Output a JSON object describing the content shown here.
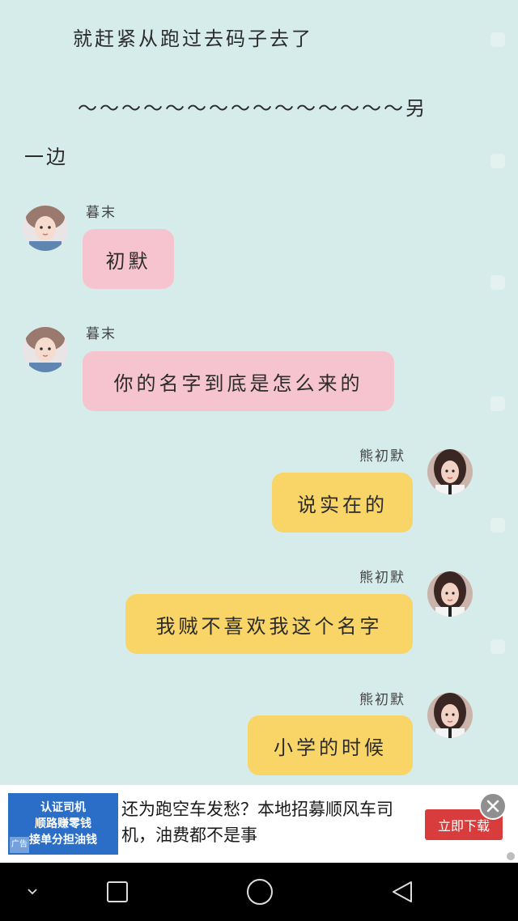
{
  "story": {
    "line1": "就赶紧从跑过去码子去了",
    "line2": "～～～～～～～～～～～～～～～另",
    "line3": "一边"
  },
  "messages": [
    {
      "side": "left",
      "name": "暮末",
      "text": "初默"
    },
    {
      "side": "left",
      "name": "暮末",
      "text": "你的名字到底是怎么来的"
    },
    {
      "side": "right",
      "name": "熊初默",
      "text": "说实在的"
    },
    {
      "side": "right",
      "name": "熊初默",
      "text": "我贼不喜欢我这个名字"
    },
    {
      "side": "right",
      "name": "熊初默",
      "text": "小学的时候"
    }
  ],
  "colors": {
    "background": "#d6ecea",
    "left_bubble": "#f6c4cf",
    "right_bubble": "#f8d566",
    "ad_button": "#d83c3c"
  },
  "ad": {
    "image_lines": [
      "认证司机",
      "顺路赚零钱",
      "接单分担油钱"
    ],
    "image_tag": "广告",
    "text": "还为跑空车发愁？本地招募顺风车司机，油费都不是事",
    "button": "立即下载",
    "close_icon": "close-icon"
  },
  "navbar": {
    "icons": [
      "chevron-down-icon",
      "square-icon",
      "circle-icon",
      "triangle-back-icon"
    ]
  }
}
